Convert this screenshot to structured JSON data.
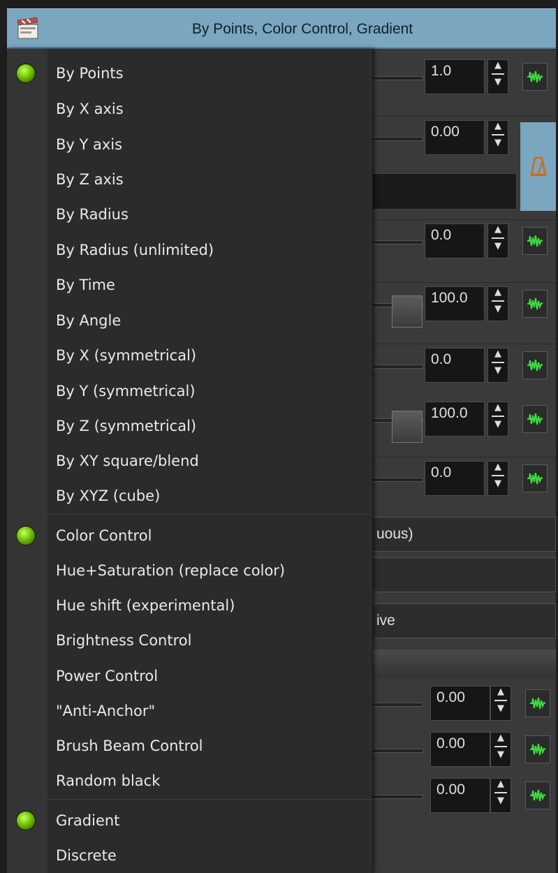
{
  "title_bar": {
    "title": "By Points, Color Control, Gradient",
    "icon": "clapper-icon"
  },
  "menu": {
    "groups": [
      {
        "items": [
          {
            "label": "By Points",
            "checked": true
          },
          {
            "label": "By X axis"
          },
          {
            "label": "By Y axis"
          },
          {
            "label": "By Z axis"
          },
          {
            "label": "By Radius"
          },
          {
            "label": "By Radius (unlimited)"
          },
          {
            "label": "By Time"
          },
          {
            "label": "By Angle"
          },
          {
            "label": "By X (symmetrical)"
          },
          {
            "label": "By Y (symmetrical)"
          },
          {
            "label": "By Z (symmetrical)"
          },
          {
            "label": "By XY square/blend"
          },
          {
            "label": "By XYZ (cube)"
          }
        ]
      },
      {
        "items": [
          {
            "label": "Color Control",
            "checked": true
          },
          {
            "label": "Hue+Saturation (replace color)"
          },
          {
            "label": "Hue shift (experimental)"
          },
          {
            "label": "Brightness Control"
          },
          {
            "label": "Power Control"
          },
          {
            "label": "\"Anti-Anchor\""
          },
          {
            "label": "Brush Beam Control"
          },
          {
            "label": "Random black"
          }
        ]
      },
      {
        "items": [
          {
            "label": "Gradient",
            "checked": true
          },
          {
            "label": "Discrete"
          }
        ]
      }
    ]
  },
  "background_panel": {
    "values": [
      "1.0",
      "0.00",
      "0.0",
      "100.0",
      "0.0",
      "100.0",
      "0.0",
      "0.00",
      "0.00",
      "0.00"
    ],
    "fields": [
      "uous)",
      "ive"
    ],
    "side_button_icon": "metronome-icon",
    "key_button_icon": "waveform-icon",
    "colors": {
      "accent": "#7aa6bf",
      "indicator": "#7fd20f"
    }
  }
}
